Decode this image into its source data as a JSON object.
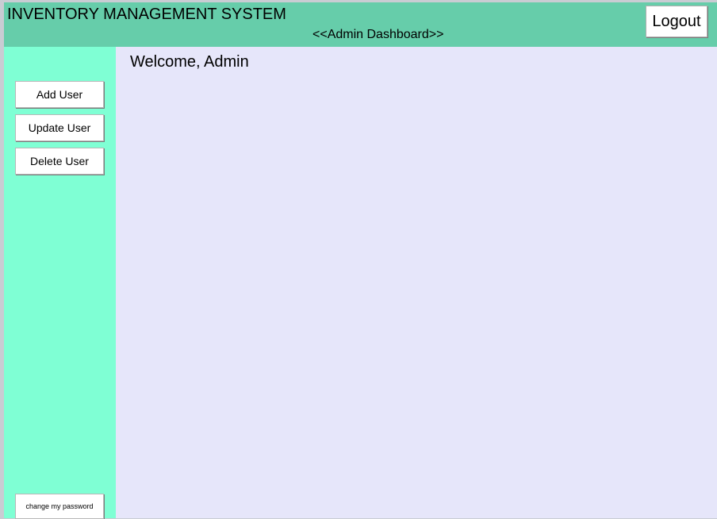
{
  "header": {
    "title": "INVENTORY MANAGEMENT SYSTEM",
    "subtitle": "<<Admin Dashboard>>",
    "logout_label": "Logout"
  },
  "sidebar": {
    "items": [
      {
        "label": "Add User"
      },
      {
        "label": "Update User"
      },
      {
        "label": "Delete User"
      }
    ],
    "change_password_label": "change my password"
  },
  "main": {
    "welcome": "Welcome, Admin"
  },
  "colors": {
    "header_bg": "#66cdaa",
    "sidebar_bg": "#7fffd4",
    "content_bg": "#e6e6fa"
  }
}
